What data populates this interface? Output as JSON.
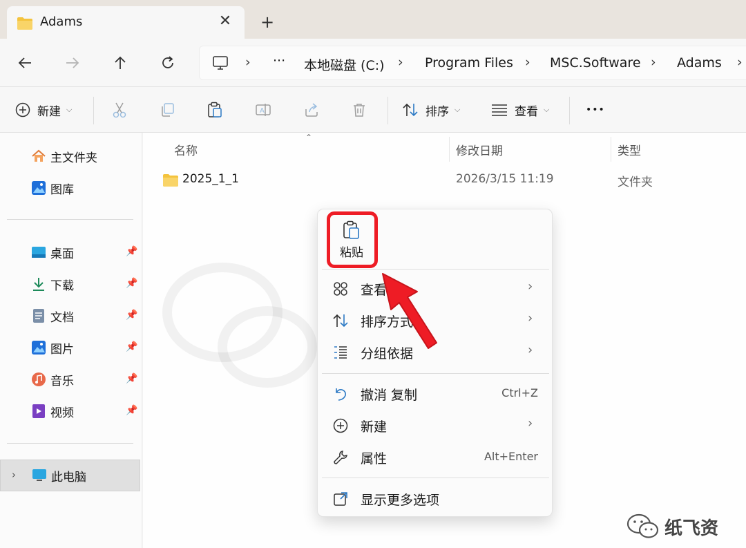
{
  "tab": {
    "title": "Adams",
    "close": "✕",
    "new": "+"
  },
  "address": {
    "overflow": "···",
    "segments": [
      "本地磁盘 (C:)",
      "Program Files",
      "MSC.Software",
      "Adams"
    ],
    "sep": "›"
  },
  "toolbar": {
    "new_label": "新建",
    "sort_label": "排序",
    "view_label": "查看",
    "more": "•••"
  },
  "sidebar": {
    "top": [
      {
        "label": "主文件夹",
        "icon": "home-icon"
      },
      {
        "label": "图库",
        "icon": "gallery-icon"
      }
    ],
    "pinned": [
      {
        "label": "桌面",
        "icon": "desktop-icon"
      },
      {
        "label": "下载",
        "icon": "download-icon"
      },
      {
        "label": "文档",
        "icon": "documents-icon"
      },
      {
        "label": "图片",
        "icon": "pictures-icon"
      },
      {
        "label": "音乐",
        "icon": "music-icon"
      },
      {
        "label": "视频",
        "icon": "videos-icon"
      }
    ],
    "this_pc": "此电脑"
  },
  "columns": {
    "name": "名称",
    "date": "修改日期",
    "type": "类型"
  },
  "files": [
    {
      "name": "2025_1_1",
      "date": "2026/3/15 11:19",
      "type": "文件夹"
    }
  ],
  "context_menu": {
    "paste": "粘贴",
    "items": [
      {
        "label": "查看",
        "submenu": true,
        "icon": "grid-icon"
      },
      {
        "label": "排序方式",
        "submenu": true,
        "icon": "sort-icon"
      },
      {
        "label": "分组依据",
        "submenu": true,
        "icon": "group-icon"
      },
      {
        "label": "撤消 复制",
        "shortcut": "Ctrl+Z",
        "icon": "undo-icon"
      },
      {
        "label": "新建",
        "submenu": true,
        "icon": "new-icon"
      },
      {
        "label": "属性",
        "shortcut": "Alt+Enter",
        "icon": "wrench-icon"
      },
      {
        "label": "显示更多选项",
        "icon": "more-options-icon"
      }
    ]
  },
  "watermark": "纸飞资",
  "colors": {
    "highlight": "#ee1c25",
    "folder": "#f4c33d",
    "accent": "#0067c0"
  }
}
